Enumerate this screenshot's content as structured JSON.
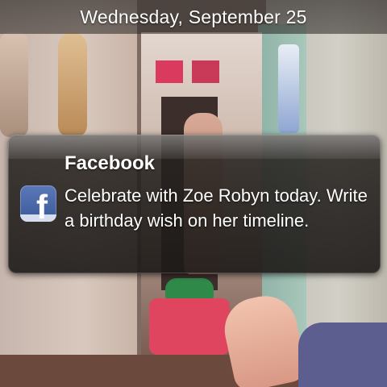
{
  "status_bar": {
    "date": "Wednesday, September 25"
  },
  "notification": {
    "app_name": "Facebook",
    "message": "Celebrate with Zoe Robyn today. Write a birthday wish on her timeline.",
    "app_icon": "facebook-icon",
    "app_icon_glyph": "f",
    "brand_color": "#3b5998"
  }
}
